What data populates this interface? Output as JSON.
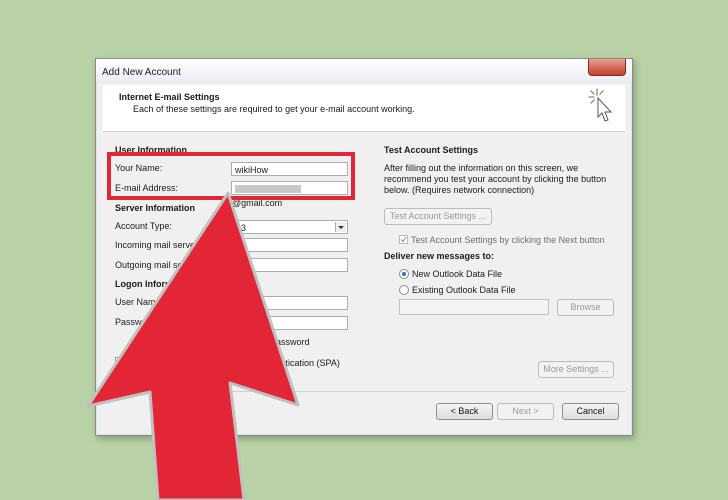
{
  "window": {
    "title": "Add New Account"
  },
  "header": {
    "title": "Internet E-mail Settings",
    "subtitle": "Each of these settings are required to get your e-mail account working."
  },
  "user_info": {
    "section": "User Information",
    "your_name_label": "Your Name:",
    "your_name_value": "wikiHow",
    "email_label": "E-mail Address:",
    "email_value": "@gmail.com"
  },
  "server_info": {
    "section": "Server Information",
    "account_type_label": "Account Type:",
    "account_type_value": "P3",
    "incoming_label": "Incoming mail server:",
    "outgoing_label": "Outgoing mail serv"
  },
  "logon_info": {
    "section": "Logon Inform",
    "user_name_label": "User Name",
    "password_label": "Passwor",
    "remember_fragment": "assword",
    "spa_fragment": "thentication (SPA)"
  },
  "test": {
    "section": "Test Account Settings",
    "description_line1": "After filling out the information on this screen, we",
    "description_line2": "recommend you test your account by clicking the button",
    "description_line3": "below. (Requires network connection)",
    "button": "Test Account Settings ...",
    "checkbox_label": "Test Account Settings by clicking the Next button"
  },
  "deliver": {
    "section": "Deliver new messages to:",
    "option_new": "New Outlook Data File",
    "option_existing": "Existing Outlook Data File",
    "browse": "Browse",
    "more_settings": "More Settings ..."
  },
  "footer": {
    "back": "< Back",
    "next": "Next >",
    "cancel": "Cancel"
  },
  "colors": {
    "highlight": "#e32636",
    "arrow": "#e32636",
    "background": "#b9d2a5"
  }
}
